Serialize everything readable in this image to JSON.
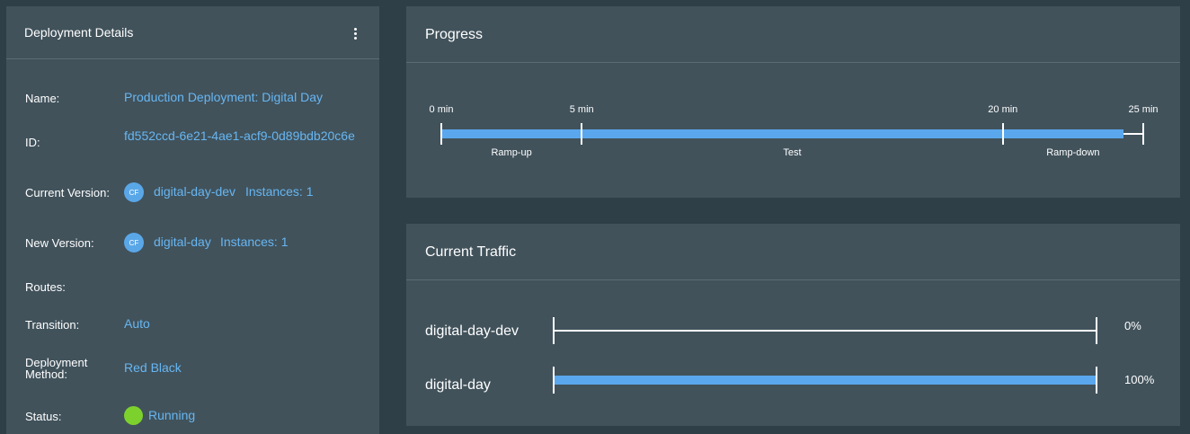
{
  "details": {
    "title": "Deployment Details",
    "fields": {
      "name_label": "Name:",
      "name_value": "Production Deployment: Digital Day",
      "id_label": "ID:",
      "id_value": "fd552ccd-6e21-4ae1-acf9-0d89bdb20c6e",
      "current_label": "Current Version:",
      "current_badge": "CF",
      "current_app": "digital-day-dev",
      "current_instances": "Instances: 1",
      "new_label": "New Version:",
      "new_badge": "CF",
      "new_app": "digital-day",
      "new_instances": "Instances: 1",
      "routes_label": "Routes:",
      "transition_label": "Transition:",
      "transition_value": "Auto",
      "method_label": "Deployment Method:",
      "method_value": "Red Black",
      "status_label": "Status:",
      "status_value": "Running"
    }
  },
  "progress": {
    "title": "Progress",
    "ticks": [
      "0 min",
      "5 min",
      "20 min",
      "25 min"
    ],
    "tick_minutes": [
      0,
      5,
      20,
      25
    ],
    "phases": [
      "Ramp-up",
      "Test",
      "Ramp-down"
    ],
    "elapsed_minutes": 24.3,
    "total_minutes": 25
  },
  "traffic": {
    "title": "Current Traffic",
    "rows": [
      {
        "name": "digital-day-dev",
        "percent_label": "0%",
        "fraction": 0
      },
      {
        "name": "digital-day",
        "percent_label": "100%",
        "fraction": 1
      }
    ]
  },
  "colors": {
    "background": "#2e3f48",
    "panel": "#41525b",
    "accent": "#67b6f2",
    "bar": "#5aa7ed",
    "status_running": "#7dd12c"
  },
  "icons": {
    "menu": "kebab-menu-icon",
    "version": "cloud-foundry-badge-icon",
    "status": "status-dot-icon"
  }
}
